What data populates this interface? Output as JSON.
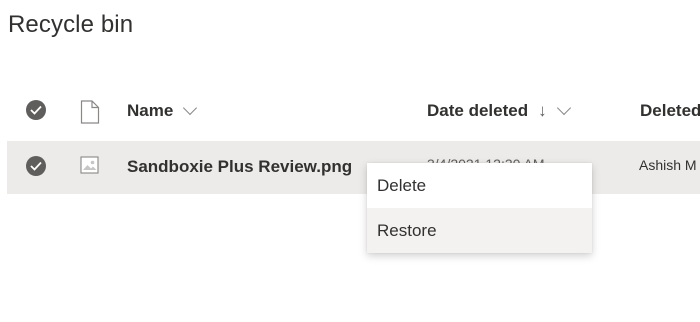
{
  "page": {
    "title": "Recycle bin"
  },
  "header": {
    "name_label": "Name",
    "date_deleted_label": "Date deleted",
    "sort_indicator": "↓",
    "deleted_by_label": "Deleted"
  },
  "rows": [
    {
      "name": "Sandboxie Plus Review.png",
      "date_deleted": "3/4/2021 12:30 AM",
      "deleted_by": "Ashish M",
      "selected": true,
      "file_icon": "image-file-icon"
    }
  ],
  "context_menu": {
    "items": [
      {
        "label": "Delete"
      },
      {
        "label": "Restore"
      }
    ],
    "hovered_index": 1
  },
  "colors": {
    "selected_row_bg": "#edebe9",
    "check_circle": "#605e5c",
    "menu_hover_bg": "#f3f2f1"
  }
}
